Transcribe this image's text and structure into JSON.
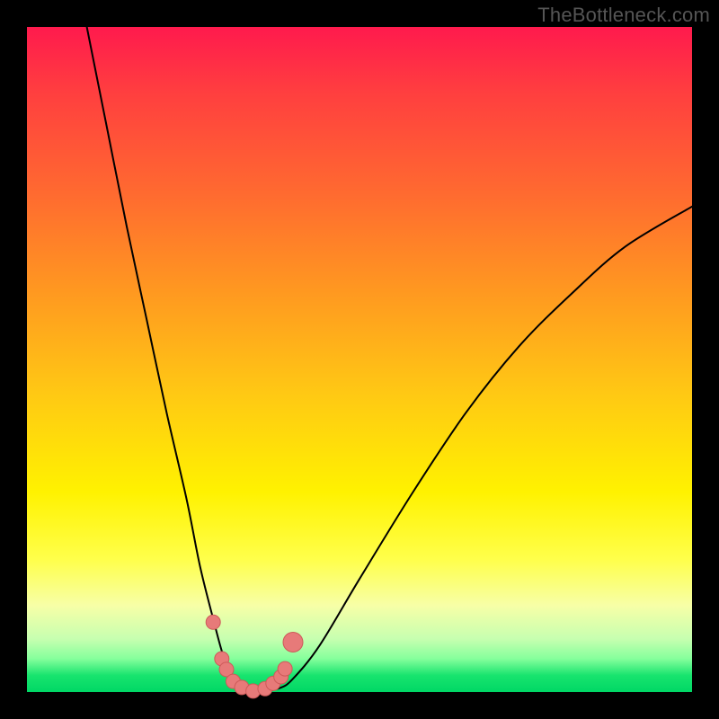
{
  "watermark": "TheBottleneck.com",
  "chart_data": {
    "type": "line",
    "title": "",
    "xlabel": "",
    "ylabel": "",
    "xlim": [
      0,
      100
    ],
    "ylim": [
      0,
      100
    ],
    "series": [
      {
        "name": "curve",
        "x": [
          9,
          12,
          15,
          18,
          21,
          24,
          26,
          28,
          29.5,
          31,
          33,
          35,
          38,
          40,
          44,
          50,
          58,
          66,
          74,
          82,
          90,
          100
        ],
        "y": [
          100,
          85,
          70,
          56,
          42,
          29,
          19,
          11,
          5.5,
          2.0,
          0.6,
          0.1,
          0.6,
          2.0,
          7,
          17,
          30,
          42,
          52,
          60,
          67,
          73
        ]
      },
      {
        "name": "markers",
        "x": [
          28.0,
          29.3,
          30.0,
          31.0,
          32.3,
          34.0,
          35.8,
          37.0,
          38.2,
          38.8,
          40.0
        ],
        "y": [
          10.5,
          5.0,
          3.4,
          1.6,
          0.7,
          0.15,
          0.5,
          1.3,
          2.3,
          3.5,
          7.5
        ],
        "r": [
          8,
          8,
          8,
          8,
          8,
          8,
          8,
          8,
          8,
          8,
          11
        ]
      }
    ],
    "colors": {
      "curve": "#000000",
      "marker_fill": "#e77a79",
      "marker_stroke": "#cd5a59"
    }
  }
}
